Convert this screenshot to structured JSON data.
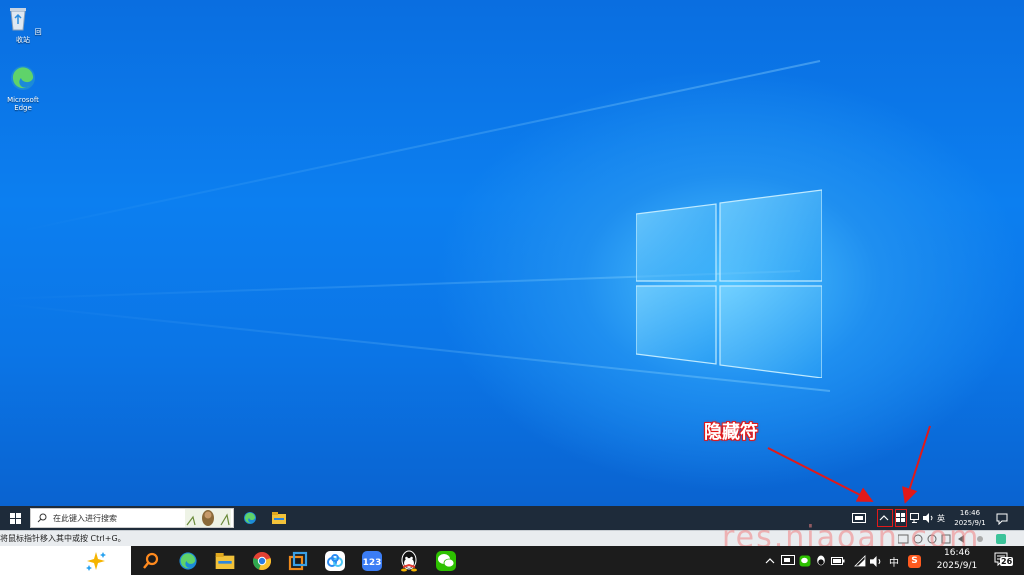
{
  "desktop": {
    "icons": [
      {
        "label": "回收站",
        "icon": "recycle-bin-icon"
      },
      {
        "label": "Microsoft Edge",
        "icon": "edge-icon"
      }
    ],
    "annotation": "隐藏符"
  },
  "taskbar_top": {
    "search_placeholder": "在此键入进行搜索",
    "apps": [
      "edge-icon",
      "file-explorer-icon"
    ],
    "tray": {
      "ime_lang": "英"
    },
    "clock": {
      "time": "16:46",
      "date": "2025/9/1"
    }
  },
  "status_strip": {
    "message": "将鼠标指针移入其中或按 Ctrl+G。",
    "watermark": "res.niaoan.com"
  },
  "taskbar_bottom": {
    "apps": [
      "copilot-sparkle-icon",
      "search-icon",
      "edge-icon",
      "file-explorer-icon",
      "chrome-icon",
      "vmware-icon",
      "baidu-netdisk-icon",
      "123-pan-icon",
      "qq-icon",
      "wechat-icon"
    ],
    "tray": {
      "ime_mode": "中",
      "ime_badge": "S"
    },
    "clock": {
      "time": "16:46",
      "date": "2025/9/1"
    },
    "notification_count": "26"
  },
  "colors": {
    "accent_red": "#e21919",
    "desktop_blue": "#0c7ff0"
  }
}
